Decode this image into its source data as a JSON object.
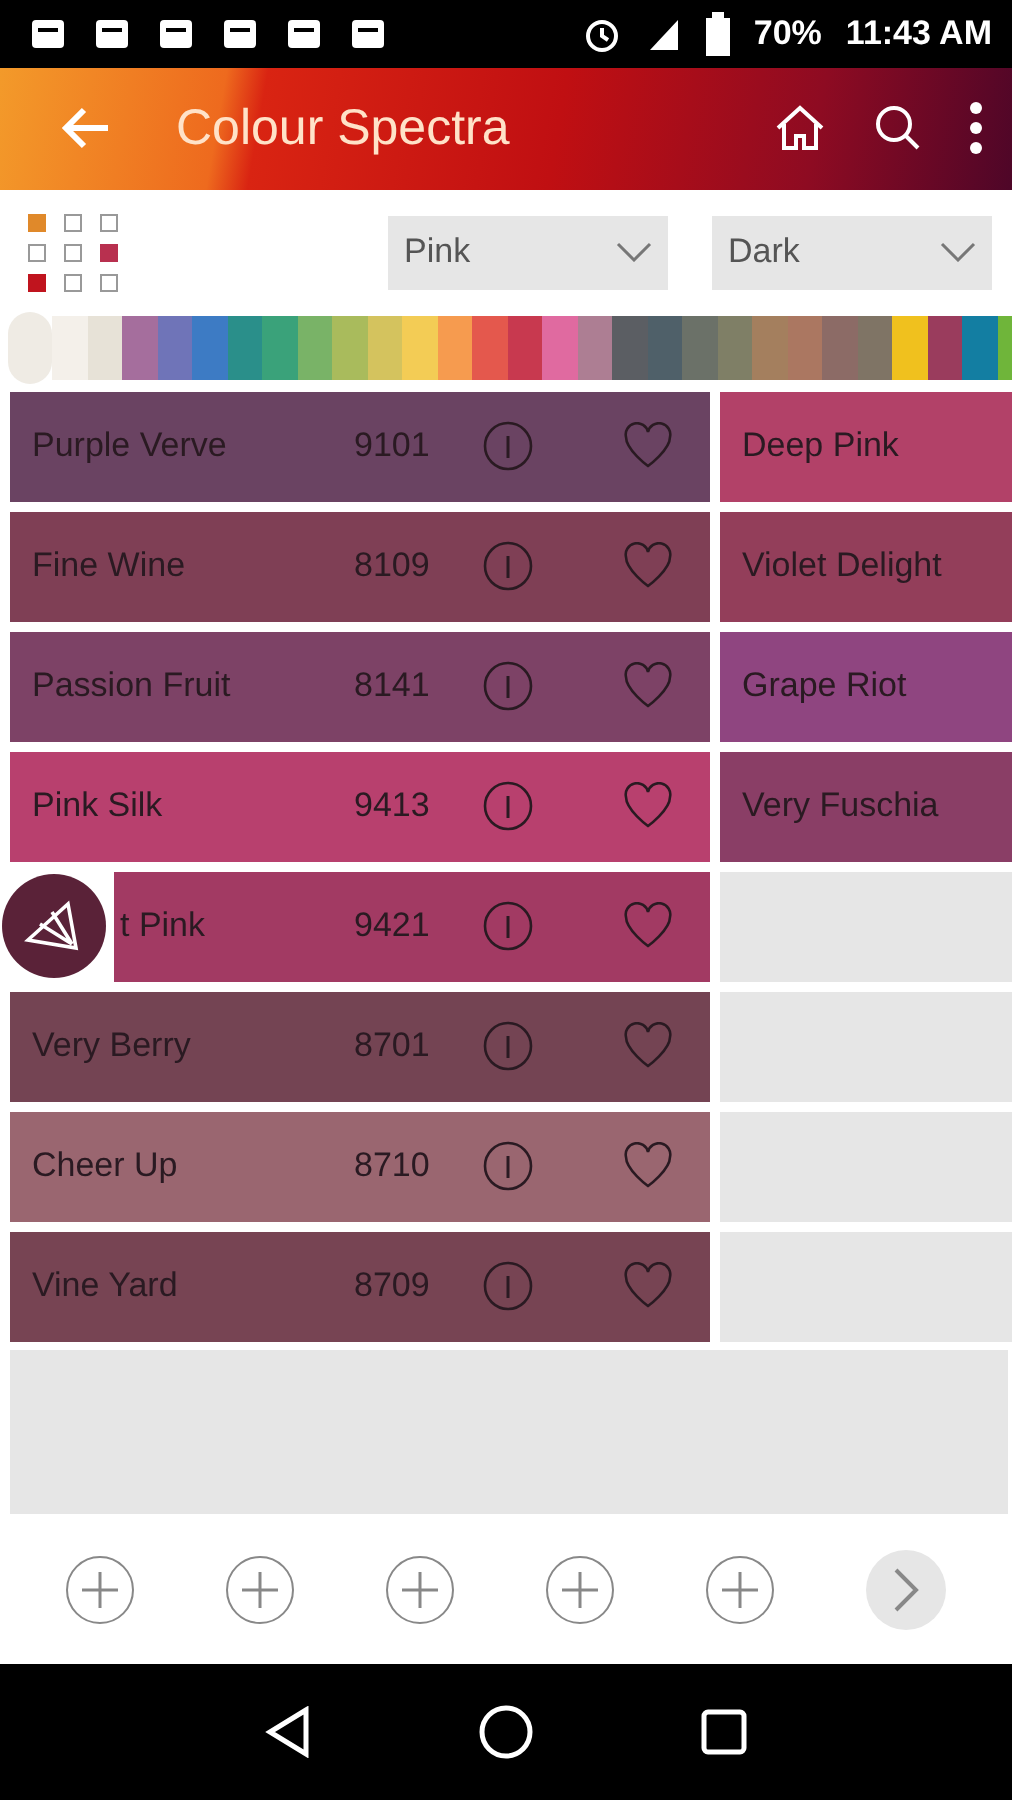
{
  "status_bar": {
    "battery": "70%",
    "time": "11:43 AM"
  },
  "app_bar": {
    "title": "Colour Spectra"
  },
  "palette_grid": [
    {
      "filled": true,
      "color": "#e0892a"
    },
    {
      "filled": false
    },
    {
      "filled": false
    },
    {
      "filled": false
    },
    {
      "filled": false
    },
    {
      "filled": true,
      "color": "#b8304f"
    },
    {
      "filled": true,
      "color": "#c0141e"
    },
    {
      "filled": false
    },
    {
      "filled": false
    }
  ],
  "filters": [
    {
      "value": "Pink"
    },
    {
      "value": "Dark"
    }
  ],
  "swatches": [
    {
      "color": "#f4f0ea"
    },
    {
      "color": "#e7e2d7"
    },
    {
      "color": "#a56e9d"
    },
    {
      "color": "#6f74b8"
    },
    {
      "color": "#3d7bc4"
    },
    {
      "color": "#2a8f8a"
    },
    {
      "color": "#3aa27a"
    },
    {
      "color": "#79b367"
    },
    {
      "color": "#a9bb5c"
    },
    {
      "color": "#d4c35e"
    },
    {
      "color": "#f3cc55"
    },
    {
      "color": "#f69b4f"
    },
    {
      "color": "#e4584d"
    },
    {
      "color": "#c8394f"
    },
    {
      "color": "#e06aa0"
    },
    {
      "color": "#ad7e93"
    },
    {
      "color": "#5b5e63"
    },
    {
      "color": "#4f6069"
    },
    {
      "color": "#6b7168"
    },
    {
      "color": "#7f7f66"
    },
    {
      "color": "#a47f5e"
    },
    {
      "color": "#ab7761"
    },
    {
      "color": "#8c6b66"
    },
    {
      "color": "#7f7465"
    },
    {
      "color": "#f0c11e"
    },
    {
      "color": "#9a3c5d"
    },
    {
      "color": "#137ea2"
    },
    {
      "color": "#6fb53a"
    }
  ],
  "colours": [
    {
      "name": "Purple Verve",
      "code": "9101",
      "color": "#6a4362",
      "partly_hidden": false
    },
    {
      "name": "Fine Wine",
      "code": "8109",
      "color": "#7f3f55",
      "partly_hidden": false
    },
    {
      "name": "Passion Fruit",
      "code": "8141",
      "color": "#7d4266",
      "partly_hidden": false
    },
    {
      "name": "Pink Silk",
      "code": "9413",
      "color": "#b8406e",
      "partly_hidden": false
    },
    {
      "name": "t Pink",
      "code": "9421",
      "color": "#a23a63",
      "partly_hidden": true
    },
    {
      "name": "Very Berry",
      "code": "8701",
      "color": "#744453",
      "partly_hidden": false
    },
    {
      "name": "Cheer Up",
      "code": "8710",
      "color": "#9a6670",
      "partly_hidden": false
    },
    {
      "name": "Vine Yard",
      "code": "8709",
      "color": "#774453",
      "partly_hidden": false
    }
  ],
  "related": [
    {
      "kind": "colour",
      "name": "Deep Pink",
      "color": "#b24168"
    },
    {
      "kind": "colour",
      "name": "Violet Delight",
      "color": "#933e5a"
    },
    {
      "kind": "colour",
      "name": "Grape Riot",
      "color": "#8f4580"
    },
    {
      "kind": "colour",
      "name": "Very Fuschia",
      "color": "#8a3e66"
    },
    {
      "kind": "empty"
    },
    {
      "kind": "empty"
    },
    {
      "kind": "empty"
    },
    {
      "kind": "empty"
    }
  ],
  "compare_slots": [
    {
      "kind": "add"
    },
    {
      "kind": "add"
    },
    {
      "kind": "add"
    },
    {
      "kind": "add"
    },
    {
      "kind": "add"
    },
    {
      "kind": "next"
    }
  ]
}
